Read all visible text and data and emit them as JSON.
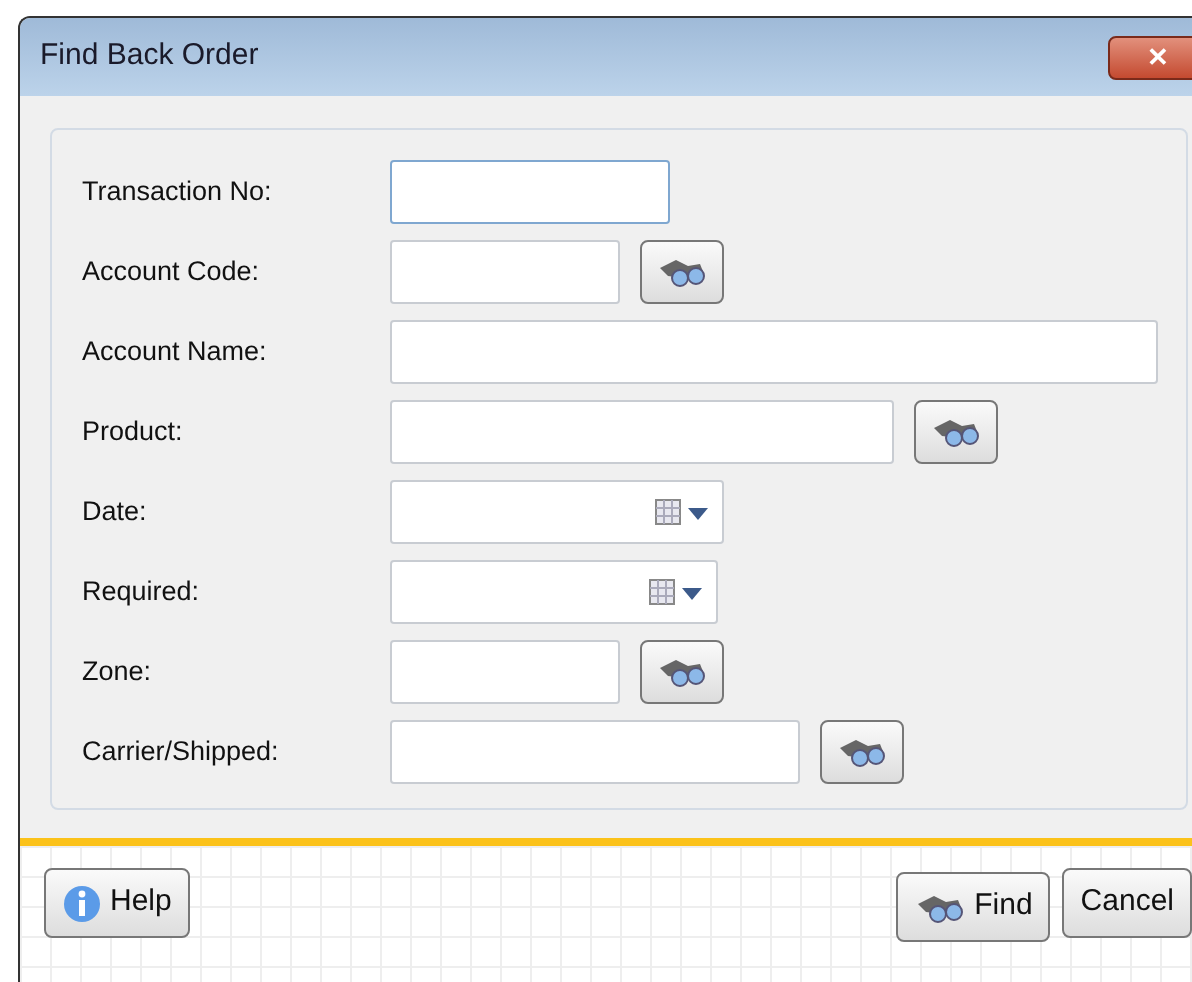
{
  "window": {
    "title": "Find Back Order",
    "close_symbol": "✕"
  },
  "fields": [
    {
      "label": "Transaction No:",
      "kind": "text",
      "focused": true
    },
    {
      "label": "Account Code:",
      "kind": "lookup",
      "focused": false
    },
    {
      "label": "Account Name:",
      "kind": "text",
      "focused": false
    },
    {
      "label": "Product:",
      "kind": "lookup",
      "focused": false
    },
    {
      "label": "Date:",
      "kind": "date",
      "focused": false
    },
    {
      "label": "Required:",
      "kind": "date",
      "focused": false
    },
    {
      "label": "Zone:",
      "kind": "lookup",
      "focused": false
    },
    {
      "label": "Carrier/Shipped:",
      "kind": "lookup",
      "focused": false
    }
  ],
  "buttons": [
    {
      "label": "Help",
      "kind": "help"
    },
    {
      "label": "Find",
      "kind": "find"
    },
    {
      "label": "Cancel",
      "kind": "plain"
    }
  ]
}
